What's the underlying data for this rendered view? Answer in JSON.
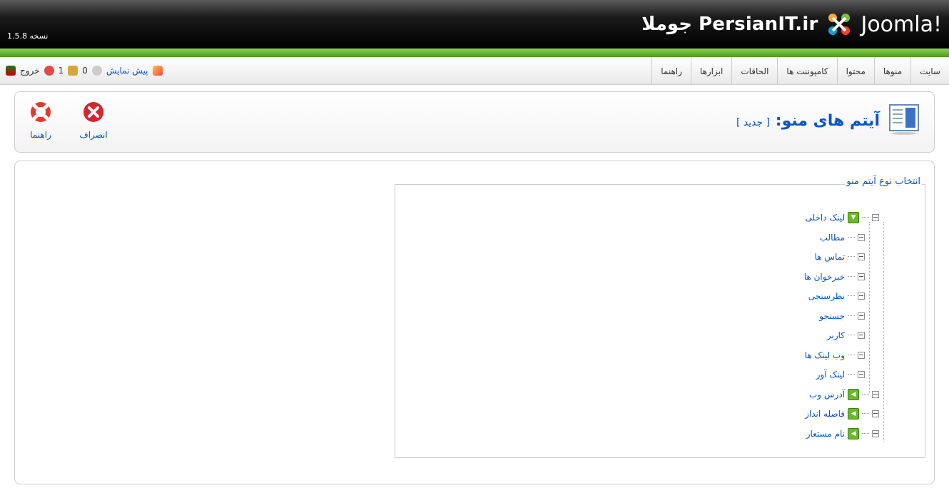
{
  "header": {
    "version_text": "نسخه 1.5.8",
    "brand_text": "جوملا PersianIT.ir",
    "joomla_word": "Joomla!"
  },
  "menu": {
    "items": [
      "سایت",
      "منوها",
      "محتوا",
      "کامپوننت ها",
      "الحاقات",
      "ابزارها",
      "راهنما"
    ]
  },
  "status": {
    "preview_label": "پیش نمایش",
    "messages_count": "0",
    "users_count": "1",
    "logout_label": "خروج"
  },
  "toolbar": {
    "title": "آیتم های منو:",
    "subtitle": "[ جدید ]",
    "cancel_label": "انصراف",
    "help_label": "راهنما"
  },
  "panel": {
    "legend": "انتخاب نوع آیتم منو",
    "tree": [
      {
        "label": "لینک داخلی",
        "level": 0,
        "icon": "green-down-icon"
      },
      {
        "label": "مطالب",
        "level": 1
      },
      {
        "label": "تماس ها",
        "level": 1
      },
      {
        "label": "خبرخوان ها",
        "level": 1
      },
      {
        "label": "نظرسنجی",
        "level": 1
      },
      {
        "label": "جستجو",
        "level": 1
      },
      {
        "label": "کاربر",
        "level": 1
      },
      {
        "label": "وب لینک ها",
        "level": 1
      },
      {
        "label": "لینک آور",
        "level": 1
      },
      {
        "label": "آدرس وب",
        "level": 0,
        "icon": "green-left-icon"
      },
      {
        "label": "فاصله انداز",
        "level": 0,
        "icon": "green-left-icon"
      },
      {
        "label": "نام مستعار",
        "level": 0,
        "icon": "green-left-icon"
      }
    ]
  },
  "colors": {
    "link": "#0b55c4",
    "accent_green": "#6ab82c"
  }
}
